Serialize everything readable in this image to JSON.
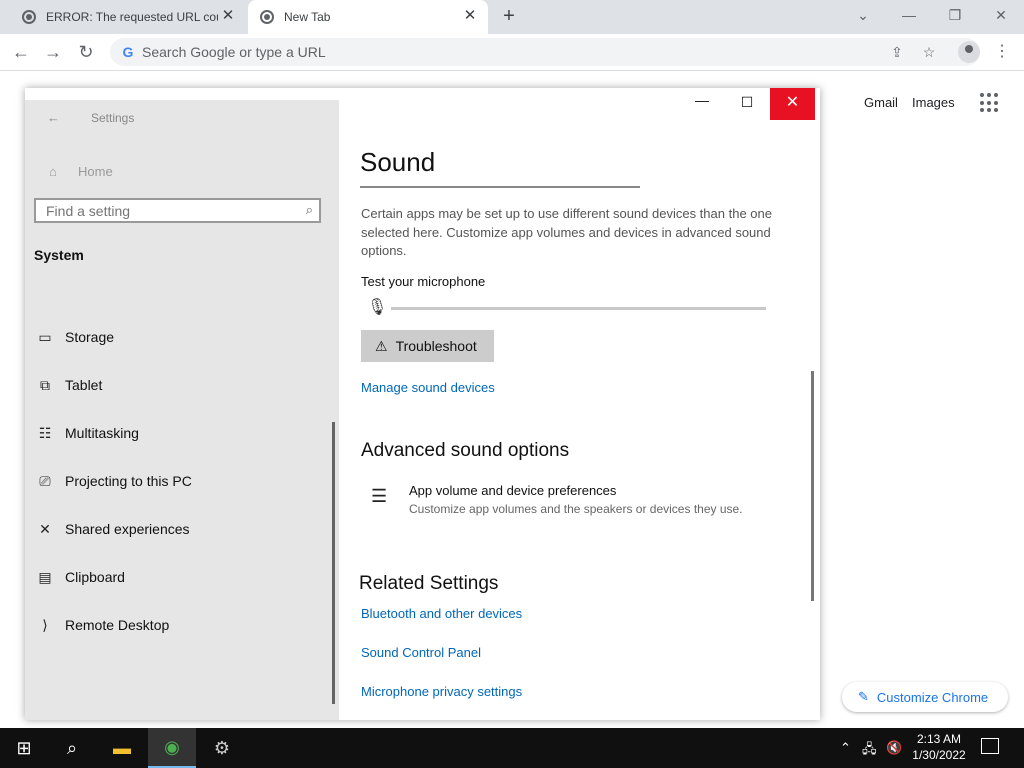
{
  "browser": {
    "tabs": [
      {
        "title": "ERROR: The requested URL could"
      },
      {
        "title": "New Tab"
      }
    ],
    "omnibox": {
      "placeholder": "Search Google or type a URL"
    },
    "ntp": {
      "gmail": "Gmail",
      "images": "Images",
      "customize": "Customize Chrome"
    }
  },
  "settings": {
    "window_title": "Settings",
    "home": "Home",
    "search_placeholder": "Find a setting",
    "section": "System",
    "nav_items": [
      {
        "label": "Storage",
        "icon": "storage-icon"
      },
      {
        "label": "Tablet",
        "icon": "tablet-icon"
      },
      {
        "label": "Multitasking",
        "icon": "multitasking-icon"
      },
      {
        "label": "Projecting to this PC",
        "icon": "projecting-icon"
      },
      {
        "label": "Shared experiences",
        "icon": "shared-experiences-icon"
      },
      {
        "label": "Clipboard",
        "icon": "clipboard-icon"
      },
      {
        "label": "Remote Desktop",
        "icon": "remote-desktop-icon"
      }
    ],
    "page": {
      "title": "Sound",
      "description": "Certain apps may be set up to use different sound devices than the one selected here. Customize app volumes and devices in advanced sound options.",
      "mic_label": "Test your microphone",
      "mic_level": 0,
      "troubleshoot": "Troubleshoot",
      "manage_link": "Manage sound devices",
      "advanced_heading": "Advanced sound options",
      "pref_title": "App volume and device preferences",
      "pref_sub": "Customize app volumes and the speakers or devices they use.",
      "related_heading": "Related Settings",
      "related_links": [
        "Bluetooth and other devices",
        "Sound Control Panel",
        "Microphone privacy settings"
      ]
    }
  },
  "taskbar": {
    "time": "2:13 AM",
    "date": "1/30/2022"
  },
  "colors": {
    "accent": "#0067b8",
    "close_red": "#e81123",
    "chrome_blue": "#1a73e8"
  }
}
